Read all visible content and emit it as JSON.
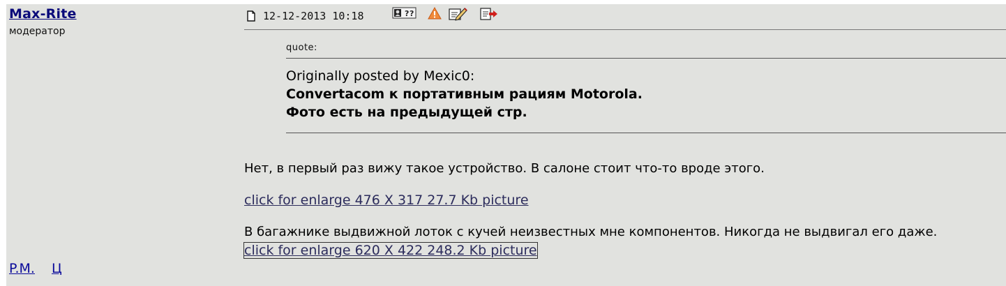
{
  "author": {
    "name": "Max-Rite",
    "role": "модератор",
    "links": [
      "P.M.",
      "Ц"
    ]
  },
  "post": {
    "date": "12-12-2013 10:18",
    "icons": [
      "profile-icon",
      "warning-icon",
      "edit-icon",
      "quote-reply-icon"
    ],
    "quote": {
      "label": "quote:",
      "intro": "Originally posted by Mexic0:",
      "lines": [
        "Convertacom к портативным рациям Motorola.",
        "Фото есть на предыдущей стр."
      ]
    },
    "text1": "Нет, в первый раз вижу такое устройство. В салоне стоит что-то вроде этого.",
    "link1": "click for enlarge 476 X 317 27.7 Kb picture",
    "text2": "В багажнике выдвижной лоток с кучей неизвестных мне компонентов. Никогда не выдвигал его даже.",
    "link2": "click for enlarge 620 X 422 248.2 Kb picture"
  },
  "colors": {
    "row_background": "#e1e2df",
    "author_link": "#0a0a7a",
    "picture_link": "#2c2c5c",
    "warning_icon": "#e8732a",
    "quote_icon_arrow": "#d0201c"
  }
}
